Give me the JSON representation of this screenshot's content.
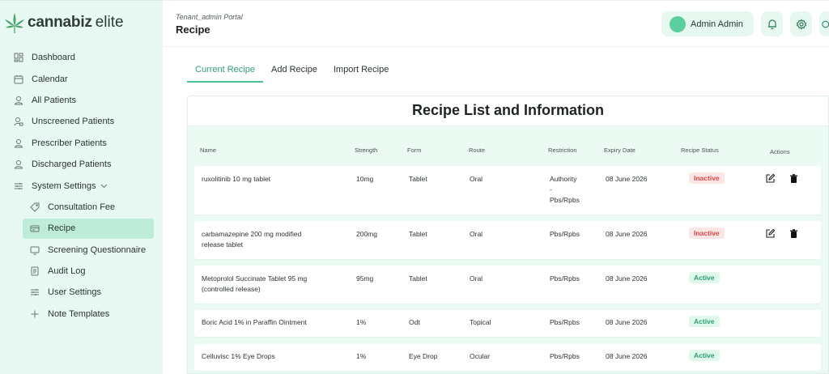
{
  "brand": {
    "name": "cannabiz",
    "suffix": "elite"
  },
  "sidebar": {
    "items": [
      {
        "label": "Dashboard",
        "icon": "dashboard-icon"
      },
      {
        "label": "Calendar",
        "icon": "calendar-icon"
      },
      {
        "label": "All Patients",
        "icon": "user-icon"
      },
      {
        "label": "Unscreened Patients",
        "icon": "user-lock-icon"
      },
      {
        "label": "Prescriber Patients",
        "icon": "user-icon"
      },
      {
        "label": "Discharged Patients",
        "icon": "user-icon"
      },
      {
        "label": "System Settings",
        "icon": "sliders-icon"
      }
    ],
    "sub_items": [
      {
        "label": "Consultation Fee",
        "icon": "tag-icon"
      },
      {
        "label": "Recipe",
        "icon": "card-icon",
        "active": true
      },
      {
        "label": "Screening Questionnaire",
        "icon": "monitor-icon"
      },
      {
        "label": "Audit Log",
        "icon": "log-icon"
      },
      {
        "label": "User Settings",
        "icon": "sliders-icon"
      },
      {
        "label": "Note Templates",
        "icon": "plus-icon"
      }
    ]
  },
  "header": {
    "portal": "Tenant_admin Portal",
    "title": "Recipe",
    "user_name": "Admin Admin"
  },
  "tabs": [
    {
      "label": "Current Recipe",
      "active": true
    },
    {
      "label": "Add Recipe"
    },
    {
      "label": "Import Recipe"
    }
  ],
  "table": {
    "title": "Recipe List and Information",
    "columns": {
      "name": "Name",
      "strength": "Strength",
      "form": "Form",
      "route": "Route",
      "restriction": "Restriction",
      "expiry": "Expiry Date",
      "status": "Recipe Status",
      "actions": "Actions"
    },
    "rows": [
      {
        "name": "ruxolitinib 10 mg tablet",
        "strength": "10mg",
        "form": "Tablet",
        "route": "Oral",
        "restriction": "Authority\n-\nPbs/Rpbs",
        "expiry": "08 June 2026",
        "status": "Inactive",
        "has_actions": true
      },
      {
        "name": "carbamazepine 200 mg modified\nrelease tablet",
        "strength": "200mg",
        "form": "Tablet",
        "route": "Oral",
        "restriction": "Pbs/Rpbs",
        "expiry": "08 June 2026",
        "status": "Inactive",
        "has_actions": true
      },
      {
        "name": "Metoprolol Succinate Tablet 95 mg\n(controlled release)",
        "strength": "95mg",
        "form": "Tablet",
        "route": "Oral",
        "restriction": "Pbs/Rpbs",
        "expiry": "08 June 2026",
        "status": "Active",
        "has_actions": false
      },
      {
        "name": "Boric Acid 1% in Paraffin Ointment",
        "strength": "1%",
        "form": "Odt",
        "route": "Topical",
        "restriction": "Pbs/Rpbs",
        "expiry": "08 June 2026",
        "status": "Active",
        "has_actions": false
      },
      {
        "name": "Celluvisc 1% Eye Drops",
        "strength": "1%",
        "form": "Eye Drop",
        "route": "Ocular",
        "restriction": "Pbs/Rpbs",
        "expiry": "08 June 2026",
        "status": "Active",
        "has_actions": false
      }
    ]
  },
  "colors": {
    "accent": "#4cc393",
    "sidebar_bg": "#e8f8f2",
    "inactive": "#d94646",
    "active": "#2e9e74"
  }
}
